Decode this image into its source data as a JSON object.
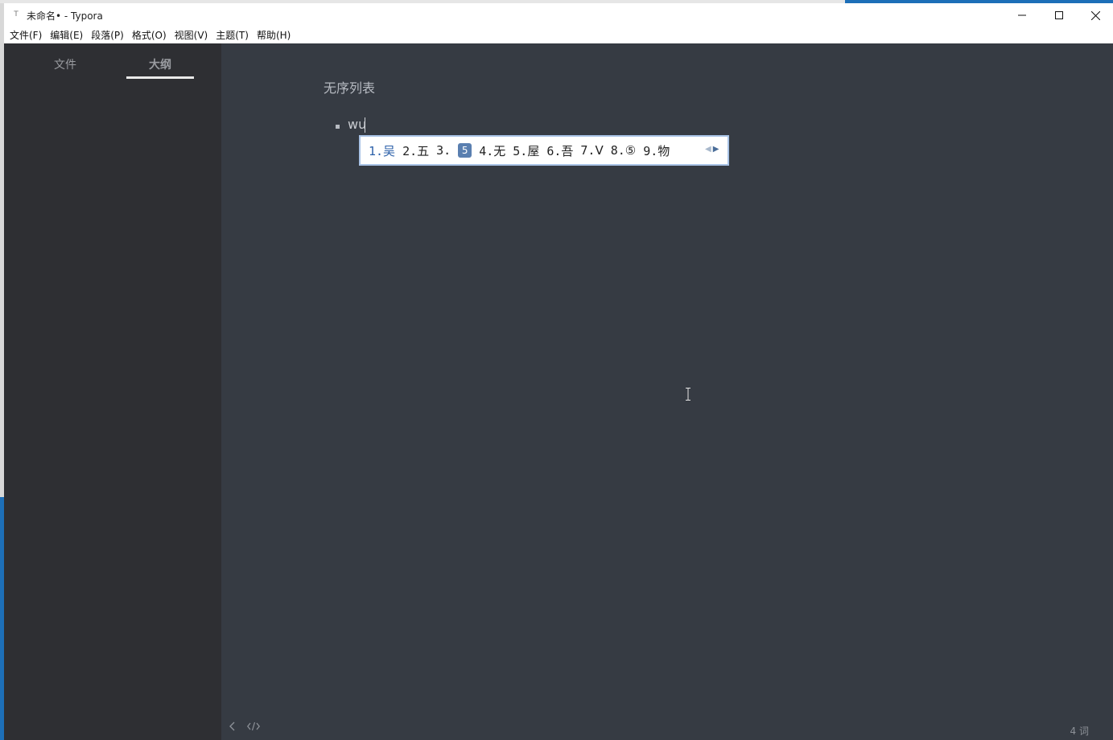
{
  "window": {
    "title": "未命名• - Typora",
    "icon_glyph": "T"
  },
  "menu": {
    "items": [
      "文件(F)",
      "编辑(E)",
      "段落(P)",
      "格式(O)",
      "视图(V)",
      "主题(T)",
      "帮助(H)"
    ]
  },
  "sidebar": {
    "tab_files": "文件",
    "tab_outline": "大纲",
    "active_tab": "大纲"
  },
  "document": {
    "heading": "无序列表",
    "list_item": "wu"
  },
  "ime": {
    "candidates": [
      "1.吴",
      "2.五",
      "3.",
      "4.无",
      "5.屋",
      "6.吾",
      "7.Ⅴ",
      "8.⑤",
      "9.物"
    ],
    "badge": "5"
  },
  "footer": {
    "word_count": "4 词"
  },
  "colors": {
    "editor_bg": "#363b43",
    "sidebar_bg": "#2e2f33",
    "ime_border": "#a9c3e6",
    "accent_blue": "#1d6fb8"
  },
  "icons": [
    "minimize-icon",
    "maximize-icon",
    "close-icon",
    "chevron-left-icon",
    "code-icon",
    "i-beam-cursor-icon"
  ]
}
